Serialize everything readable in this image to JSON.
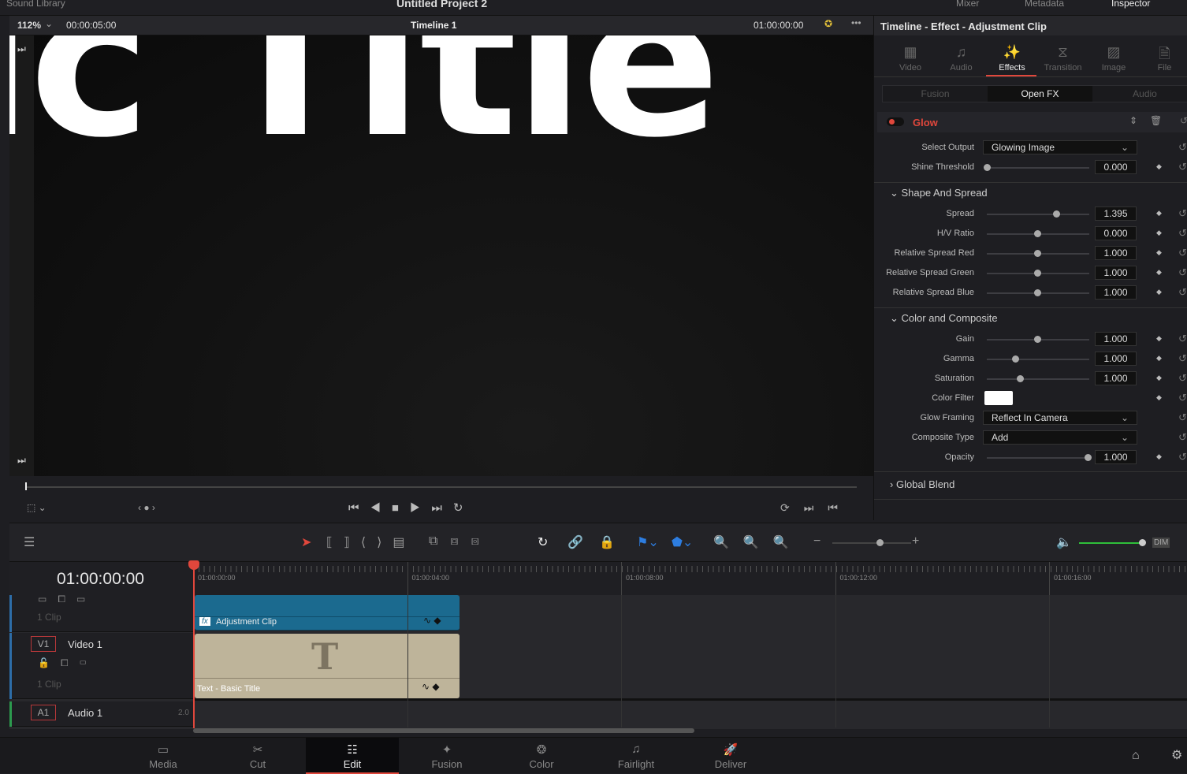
{
  "topbar": {
    "left": "Sound Library",
    "project": "Untitled Project 2",
    "mixer": "Mixer",
    "metadata": "Metadata",
    "inspector": "Inspector"
  },
  "viewer": {
    "zoom": "112%",
    "duration": "00:00:05:00",
    "timeline": "Timeline 1",
    "timecode": "01:00:00:00",
    "title_text": "ic Title"
  },
  "inspector": {
    "title": "Timeline - Effect - Adjustment Clip",
    "tabs": [
      {
        "label": "Video",
        "icon": "film-icon"
      },
      {
        "label": "Audio",
        "icon": "note-icon"
      },
      {
        "label": "Effects",
        "icon": "magic-wand-icon"
      },
      {
        "label": "Transition",
        "icon": "transition-icon"
      },
      {
        "label": "Image",
        "icon": "image-icon"
      },
      {
        "label": "File",
        "icon": "file-icon"
      }
    ],
    "active_tab": "Effects",
    "subtabs": [
      "Fusion",
      "Open FX",
      "Audio"
    ],
    "effect": "Glow",
    "params": [
      {
        "label": "Select Output",
        "type": "dropdown",
        "value": "Glowing Image"
      },
      {
        "label": "Shine Threshold",
        "type": "slider",
        "value": "0.000",
        "level": 0.0
      }
    ],
    "sections": [
      {
        "title": "Shape And Spread",
        "params": [
          {
            "label": "Spread",
            "type": "slider",
            "value": "1.395",
            "level": 0.69
          },
          {
            "label": "H/V Ratio",
            "type": "slider",
            "value": "0.000",
            "level": 0.5
          },
          {
            "label": "Relative Spread Red",
            "type": "slider",
            "value": "1.000",
            "level": 0.5
          },
          {
            "label": "Relative Spread Green",
            "type": "slider",
            "value": "1.000",
            "level": 0.5
          },
          {
            "label": "Relative Spread Blue",
            "type": "slider",
            "value": "1.000",
            "level": 0.5
          }
        ]
      },
      {
        "title": "Color and Composite",
        "params": [
          {
            "label": "Gain",
            "type": "slider",
            "value": "1.000",
            "level": 0.5
          },
          {
            "label": "Gamma",
            "type": "slider",
            "value": "1.000",
            "level": 0.28
          },
          {
            "label": "Saturation",
            "type": "slider",
            "value": "1.000",
            "level": 0.33
          },
          {
            "label": "Color Filter",
            "type": "color",
            "value": "#ffffff"
          },
          {
            "label": "Glow Framing",
            "type": "dropdown",
            "value": "Reflect In Camera"
          },
          {
            "label": "Composite Type",
            "type": "dropdown",
            "value": "Add"
          },
          {
            "label": "Opacity",
            "type": "slider",
            "value": "1.000",
            "level": 1.0
          }
        ]
      }
    ],
    "global_blend": "Global Blend"
  },
  "timeline": {
    "timecode": "01:00:00:00",
    "ruler": [
      "01:00:00:00",
      "01:00:04:00",
      "01:00:08:00",
      "01:00:12:00",
      "01:00:16:00"
    ],
    "tracks": {
      "v2_clips": "1 Clip",
      "v1_id": "V1",
      "v1_name": "Video 1",
      "v1_clips": "1 Clip",
      "a1_id": "A1",
      "a1_name": "Audio 1",
      "a1_ch": "2.0"
    },
    "clips": {
      "adjustment": "Adjustment Clip",
      "fx": "fx",
      "text": "Text - Basic Title",
      "text_glyph": "T"
    },
    "dim": "DIM",
    "volume_level": 1.0,
    "zoom_level": 0.6
  },
  "nav": [
    "Media",
    "Cut",
    "Edit",
    "Fusion",
    "Color",
    "Fairlight",
    "Deliver"
  ],
  "nav_active": "Edit",
  "colors": {
    "accent": "#e0473c",
    "adjustment_clip": "#1b6a8f",
    "text_clip": "#beb49a",
    "audio_meter": "#2fbf3a"
  }
}
